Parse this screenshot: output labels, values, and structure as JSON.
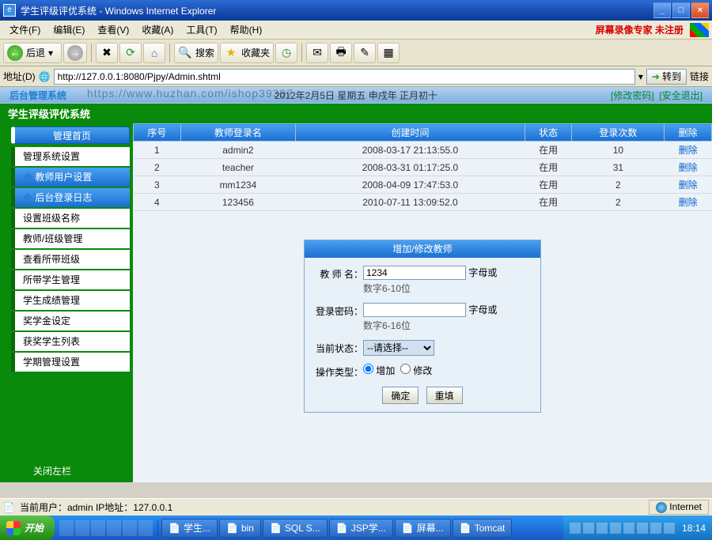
{
  "window": {
    "title": "学生评级评优系统 - Windows Internet Explorer"
  },
  "menubar": {
    "items": [
      "文件(F)",
      "编辑(E)",
      "查看(V)",
      "收藏(A)",
      "工具(T)",
      "帮助(H)"
    ],
    "unreg": "屏幕录像专家 未注册"
  },
  "toolbar": {
    "back": "后退",
    "search": "搜索",
    "fav": "收藏夹"
  },
  "addr": {
    "label": "地址(D)",
    "url": "http://127.0.0.1:8080/Pjpy/Admin.shtml",
    "go": "转到",
    "links": "链接"
  },
  "banner": {
    "left": "后台管理系统",
    "center": "2012年2月5日 星期五 申戌年 正月初十",
    "chgpwd": "[修改密码]",
    "logout": "[安全退出]",
    "watermark": "https://www.huzhan.com/ishop39397"
  },
  "appbar": "学生评级评优系统",
  "sidebar": {
    "head": "管理首页",
    "items": [
      {
        "label": "管理系统设置",
        "style": "w"
      },
      {
        "label": "教师用户设置",
        "style": "b"
      },
      {
        "label": "后台登录日志",
        "style": "b"
      },
      {
        "label": "设置班级名称",
        "style": "w"
      },
      {
        "label": "教师/班级管理",
        "style": "w"
      },
      {
        "label": "查看所带班级",
        "style": "w"
      },
      {
        "label": "所带学生管理",
        "style": "w"
      },
      {
        "label": "学生成绩管理",
        "style": "w"
      },
      {
        "label": "奖学金设定",
        "style": "w"
      },
      {
        "label": "获奖学生列表",
        "style": "w"
      },
      {
        "label": "学期管理设置",
        "style": "w"
      }
    ],
    "close": "关闭左栏"
  },
  "grid": {
    "headers": [
      "序号",
      "教师登录名",
      "创建时间",
      "状态",
      "登录次数",
      "删除"
    ],
    "rows": [
      {
        "idx": "1",
        "user": "admin2",
        "time": "2008-03-17 21:13:55.0",
        "state": "在用",
        "count": "10",
        "del": "删除"
      },
      {
        "idx": "2",
        "user": "teacher",
        "time": "2008-03-31 01:17:25.0",
        "state": "在用",
        "count": "31",
        "del": "删除"
      },
      {
        "idx": "3",
        "user": "mm1234",
        "time": "2008-04-09 17:47:53.0",
        "state": "在用",
        "count": "2",
        "del": "删除"
      },
      {
        "idx": "4",
        "user": "123456",
        "time": "2010-07-11 13:09:52.0",
        "state": "在用",
        "count": "2",
        "del": "删除"
      }
    ]
  },
  "form": {
    "title": "增加/修改教师",
    "name_label": "教 师 名：",
    "name_value": "1234",
    "name_hint": "数字6-10位",
    "name_suffix": "字母或",
    "pwd_label": "登录密码：",
    "pwd_hint": "数字6-16位",
    "pwd_suffix": "字母或",
    "state_label": "当前状态：",
    "state_option": "--请选择--",
    "op_label": "操作类型：",
    "op_add": "增加",
    "op_mod": "修改",
    "btn_ok": "确定",
    "btn_reset": "重填"
  },
  "status": {
    "user": "当前用户：admin  IP地址：127.0.0.1",
    "zone": "Internet"
  },
  "taskbar": {
    "start": "开始",
    "tasks": [
      "学生...",
      "bin",
      "SQL S...",
      "JSP学...",
      "屏幕...",
      "Tomcat"
    ],
    "clock": "18:14"
  }
}
